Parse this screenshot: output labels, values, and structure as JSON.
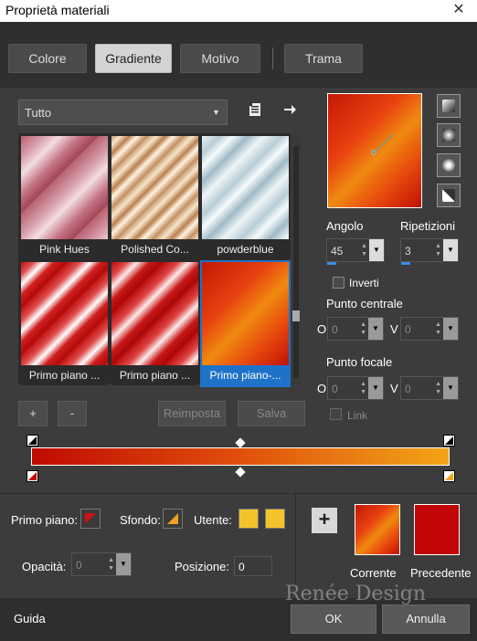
{
  "window": {
    "title": "Proprietà materiali",
    "close_glyph": "✕"
  },
  "tabs": [
    "Colore",
    "Gradiente",
    "Motivo",
    "Trama"
  ],
  "filter": {
    "selected": "Tutto"
  },
  "icons": {
    "doc": "document-menu-icon",
    "arrow": "arrow-right-icon"
  },
  "thumbnails": [
    {
      "label": "Pink Hues"
    },
    {
      "label": "Polished Co..."
    },
    {
      "label": "powderblue"
    },
    {
      "label": "Primo piano ..."
    },
    {
      "label": "Primo piano ..."
    },
    {
      "label": "Primo piano-..."
    }
  ],
  "angle": {
    "label": "Angolo",
    "value": "45"
  },
  "repeats": {
    "label": "Ripetizioni",
    "value": "3"
  },
  "invert": {
    "label": "Inverti"
  },
  "center": {
    "label": "Punto centrale",
    "o_label": "O",
    "v_label": "V",
    "o_value": "0",
    "v_value": "0"
  },
  "focal": {
    "label": "Punto focale",
    "o_label": "O",
    "v_label": "V",
    "o_value": "0",
    "v_value": "0"
  },
  "link": {
    "label": "Link"
  },
  "buttons": {
    "plus": "+",
    "minus": "-",
    "reset": "Reimposta",
    "save": "Salva"
  },
  "lower": {
    "foreground_label": "Primo piano:",
    "background_label": "Sfondo:",
    "user_label": "Utente:",
    "opacity_label": "Opacità:",
    "opacity_value": "0",
    "position_label": "Posizione:",
    "position_value": "0",
    "add_glyph": "+",
    "current_label": "Corrente",
    "previous_label": "Precedente"
  },
  "footer": {
    "help": "Guida",
    "ok": "OK",
    "cancel": "Annulla"
  },
  "watermark": "Renée Design",
  "colors": {
    "user1": "#f2c42a",
    "user2": "#f2c42a",
    "previous": "#c20505",
    "selection": "#1e73c8"
  }
}
